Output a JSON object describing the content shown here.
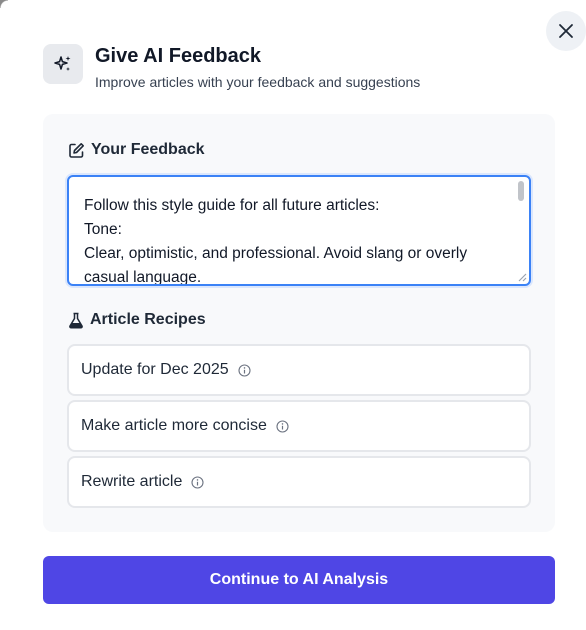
{
  "dialog": {
    "title": "Give AI Feedback",
    "subtitle": "Improve articles with your feedback and suggestions",
    "close_icon": "close-icon",
    "header_icon": "sparkles-icon"
  },
  "feedback": {
    "label": "Your Feedback",
    "icon": "edit-icon",
    "value": "Follow this style guide for all future articles:\nTone:\nClear, optimistic, and professional. Avoid slang or overly casual language."
  },
  "recipes": {
    "label": "Article Recipes",
    "icon": "flask-icon",
    "items": [
      {
        "label": "Update for Dec 2025",
        "icon": "info-icon"
      },
      {
        "label": "Make article more concise",
        "icon": "info-icon"
      },
      {
        "label": "Rewrite article",
        "icon": "info-icon"
      }
    ]
  },
  "actions": {
    "continue_label": "Continue to AI Analysis"
  },
  "colors": {
    "accent": "#4f46e5",
    "focus_border": "#3b82f6",
    "panel_bg": "#f8f9fb"
  }
}
